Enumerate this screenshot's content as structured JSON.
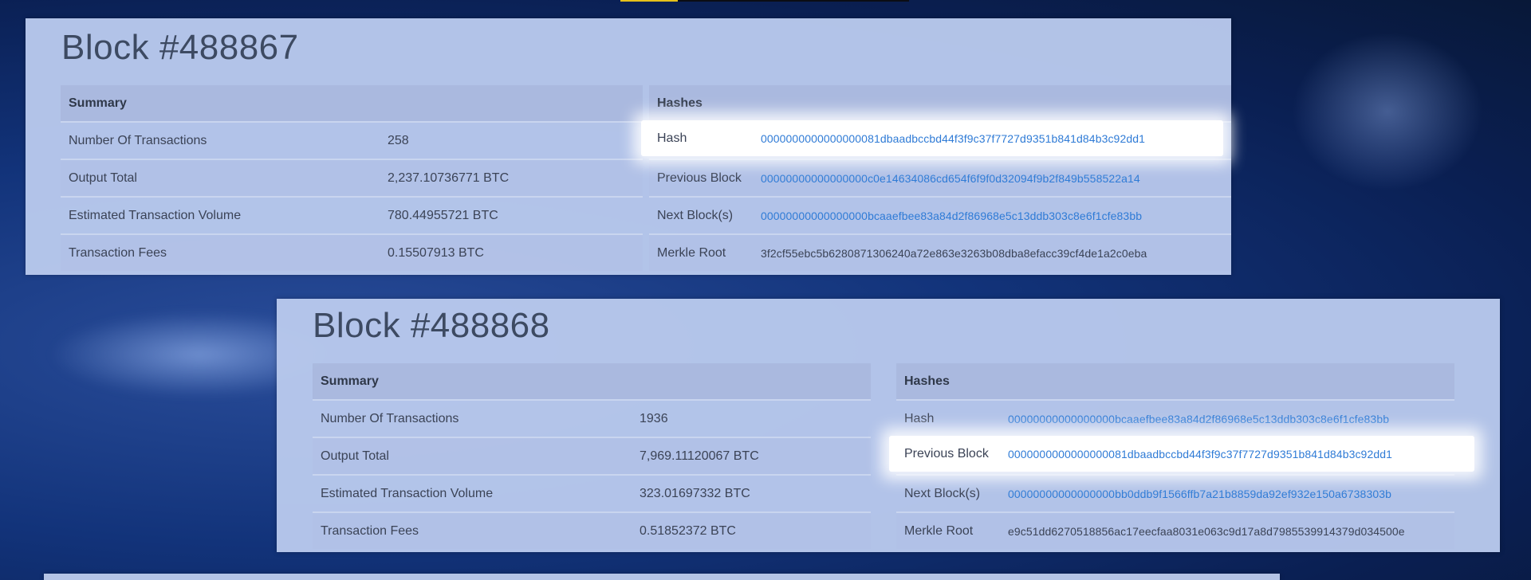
{
  "blocks": [
    {
      "title": "Block #488867",
      "summary": {
        "header": "Summary",
        "rows": [
          {
            "label": "Number Of Transactions",
            "value": "258"
          },
          {
            "label": "Output Total",
            "value": "2,237.10736771 BTC"
          },
          {
            "label": "Estimated Transaction Volume",
            "value": "780.44955721 BTC"
          },
          {
            "label": "Transaction Fees",
            "value": "0.15507913 BTC"
          }
        ]
      },
      "hashes": {
        "header": "Hashes",
        "rows": [
          {
            "label": "Hash",
            "value": "0000000000000000081dbaadbccbd44f3f9c37f7727d9351b841d84b3c92dd1"
          },
          {
            "label": "Previous Block",
            "value": "00000000000000000c0e14634086cd654f6f9f0d32094f9b2f849b558522a14"
          },
          {
            "label": "Next Block(s)",
            "value": "00000000000000000bcaaefbee83a84d2f86968e5c13ddb303c8e6f1cfe83bb"
          },
          {
            "label": "Merkle Root",
            "value": "3f2cf55ebc5b6280871306240a72e863e3263b08dba8efacc39cf4de1a2c0eba"
          }
        ]
      }
    },
    {
      "title": "Block #488868",
      "summary": {
        "header": "Summary",
        "rows": [
          {
            "label": "Number Of Transactions",
            "value": "1936"
          },
          {
            "label": "Output Total",
            "value": "7,969.11120067 BTC"
          },
          {
            "label": "Estimated Transaction Volume",
            "value": "323.01697332 BTC"
          },
          {
            "label": "Transaction Fees",
            "value": "0.51852372 BTC"
          }
        ]
      },
      "hashes": {
        "header": "Hashes",
        "rows": [
          {
            "label": "Hash",
            "value": "00000000000000000bcaaefbee83a84d2f86968e5c13ddb303c8e6f1cfe83bb"
          },
          {
            "label": "Previous Block",
            "value": "0000000000000000081dbaadbccbd44f3f9c37f7727d9351b841d84b3c92dd1"
          },
          {
            "label": "Next Block(s)",
            "value": "00000000000000000bb0ddb9f1566ffb7a21b8859da92ef932e150a6738303b"
          },
          {
            "label": "Merkle Root",
            "value": "e9c51dd6270518856ac17eecfaa8031e063c9d17a8d7985539914379d034500e"
          }
        ]
      }
    }
  ],
  "colors": {
    "link": "#2f7bd6",
    "text": "#3b4356",
    "panel": "#b8c8ec",
    "highlight": "#ffffff"
  }
}
